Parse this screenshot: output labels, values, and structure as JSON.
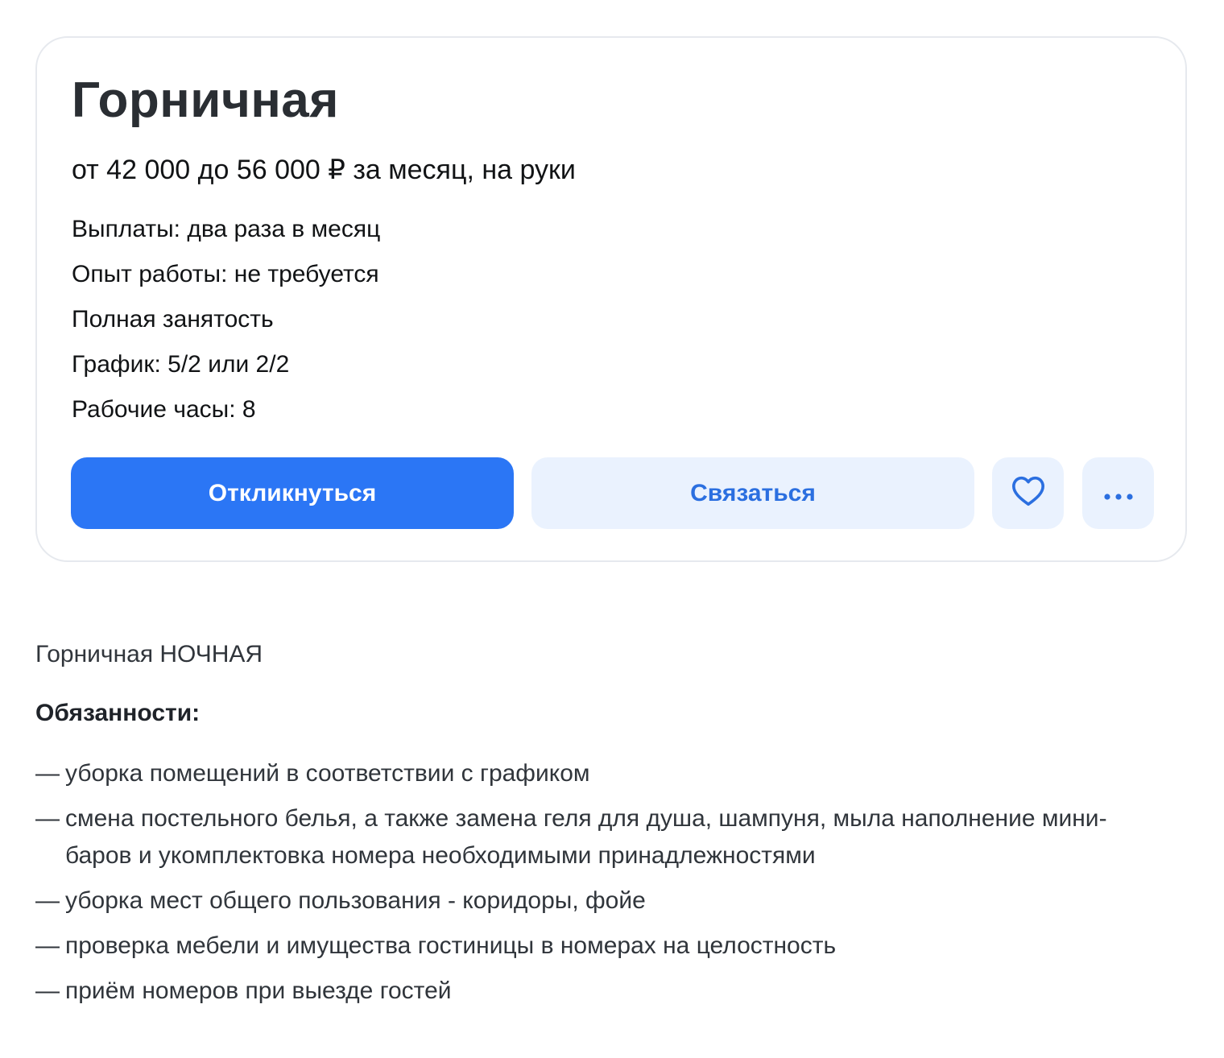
{
  "vacancy": {
    "title": "Горничная",
    "salary": "от 42 000 до 56 000 ₽ за месяц, на руки",
    "facts": [
      "Выплаты: два раза в месяц",
      "Опыт работы: не требуется",
      "Полная занятость",
      "График: 5/2 или 2/2",
      "Рабочие часы: 8"
    ],
    "actions": {
      "respond_label": "Откликнуться",
      "contact_label": "Связаться",
      "favorite_icon": "heart-icon",
      "more_icon": "more-horizontal-icon"
    }
  },
  "description": {
    "subtitle": "Горничная НОЧНАЯ",
    "duties_heading": "Обязанности:",
    "bullet": "—",
    "duties": [
      "уборка помещений в соответствии с графиком",
      "смена постельного белья, а также замена геля для душа, шампуня, мыла наполнение мини-баров и укомплектовка номера необходимыми принадлежностями",
      "уборка мест общего пользования - коридоры, фойе",
      "проверка мебели и имущества гостиницы в номерах на целостность",
      "приём номеров при выезде гостей"
    ]
  },
  "colors": {
    "primary": "#2b76f5",
    "secondary_bg": "#eaf2fe",
    "secondary_text": "#2b6fe0",
    "card_border": "#e6e9ee"
  }
}
